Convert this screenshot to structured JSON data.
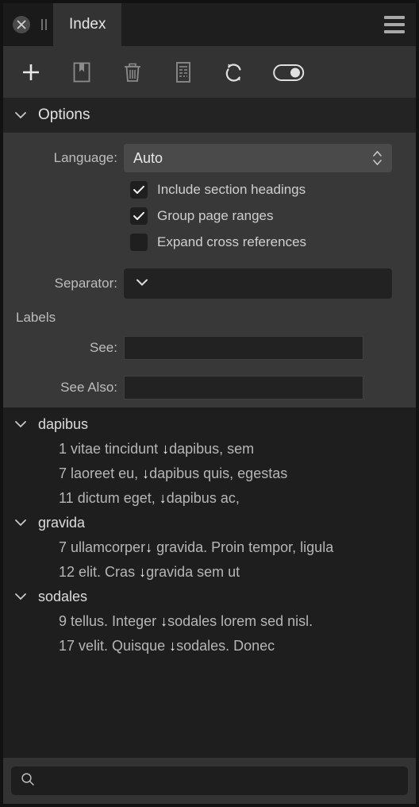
{
  "window": {
    "close_icon": "close-circle-icon",
    "pause_icon": "pause-bars-icon",
    "menu_icon": "hamburger-menu-icon"
  },
  "tabs": [
    {
      "label": "Index",
      "active": true
    }
  ],
  "toolbar": {
    "buttons": [
      {
        "name": "add-entry-button",
        "icon": "plus-icon"
      },
      {
        "name": "bookmark-button",
        "icon": "bookmark-page-icon"
      },
      {
        "name": "delete-button",
        "icon": "trash-icon"
      },
      {
        "name": "document-button",
        "icon": "document-list-icon"
      },
      {
        "name": "refresh-button",
        "icon": "refresh-sync-icon"
      },
      {
        "name": "toggle-switch",
        "icon": "toggle-on-icon"
      }
    ]
  },
  "options": {
    "header": "Options",
    "caret_icon": "chevron-down-icon",
    "language": {
      "label": "Language:",
      "value": "Auto",
      "stepper_icon": "stepper-up-down-icon"
    },
    "checkboxes": [
      {
        "label": "Include section headings",
        "checked": true
      },
      {
        "label": "Group page ranges",
        "checked": true
      },
      {
        "label": "Expand cross references",
        "checked": false
      }
    ],
    "separator": {
      "label": "Separator:",
      "value": "",
      "caret_icon": "chevron-down-icon"
    },
    "labels_heading": "Labels",
    "see": {
      "label": "See:",
      "value": "",
      "placeholder": ""
    },
    "see_also": {
      "label": "See Also:",
      "value": "",
      "placeholder": ""
    }
  },
  "index": {
    "groups": [
      {
        "name": "dapibus",
        "caret_icon": "chevron-down-icon",
        "entries": [
          {
            "page": "1",
            "before": "vitae tincidunt ",
            "arrow": "↓",
            "after": "dapibus, sem"
          },
          {
            "page": "7",
            "before": "laoreet eu, ",
            "arrow": "↓",
            "after": "dapibus quis, egestas"
          },
          {
            "page": "11",
            "before": "dictum eget, ",
            "arrow": "↓",
            "after": "dapibus ac,"
          }
        ]
      },
      {
        "name": "gravida",
        "caret_icon": "chevron-down-icon",
        "entries": [
          {
            "page": "7",
            "before": "ullamcorper",
            "arrow": "↓",
            "after": " gravida. Proin tempor, ligula"
          },
          {
            "page": "12",
            "before": "elit. Cras ",
            "arrow": "↓",
            "after": "gravida sem ut"
          }
        ]
      },
      {
        "name": "sodales",
        "caret_icon": "chevron-down-icon",
        "entries": [
          {
            "page": "9",
            "before": "tellus. Integer ",
            "arrow": "↓",
            "after": "sodales lorem sed nisl."
          },
          {
            "page": "17",
            "before": "velit. Quisque ",
            "arrow": "↓",
            "after": "sodales. Donec"
          }
        ]
      }
    ]
  },
  "search": {
    "icon": "search-icon",
    "value": "",
    "placeholder": ""
  },
  "colors": {
    "window_bg": "#121212",
    "tabbar_bg": "#1e1e1e",
    "tab_active_bg": "#333333",
    "toolbar_bg": "#333333",
    "options_header_bg": "#232323",
    "options_body_bg": "#383838",
    "list_bg": "#1e1e1e",
    "field_bg": "#222222",
    "text_primary": "#e2e2e2",
    "text_secondary": "#b6b6b6"
  }
}
